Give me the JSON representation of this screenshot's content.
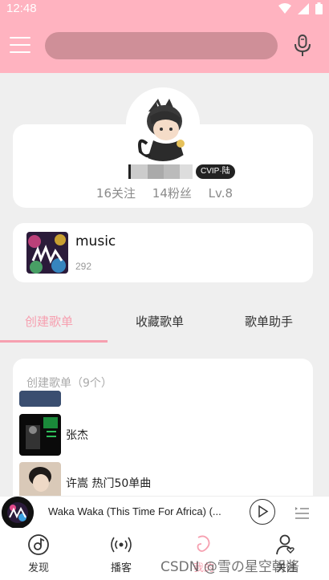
{
  "status_bar": {
    "time": "12:48"
  },
  "search": {
    "placeholder": ""
  },
  "profile": {
    "vip_badge": "CVIP·陆",
    "follow": "16关注",
    "fans": "14粉丝",
    "level": "Lv.8"
  },
  "music_card": {
    "title": "music",
    "count": "292"
  },
  "tabs": [
    {
      "label": "创建歌单"
    },
    {
      "label": "收藏歌单"
    },
    {
      "label": "歌单助手"
    }
  ],
  "playlists": {
    "header": "创建歌单（9个）",
    "items": [
      {
        "name": ""
      },
      {
        "name": "张杰"
      },
      {
        "name": "许嵩 热门50单曲"
      }
    ]
  },
  "player": {
    "title": "Waka Waka (This Time For Africa) (..."
  },
  "bottom_nav": [
    {
      "label": "发现"
    },
    {
      "label": "播客"
    },
    {
      "label": "我的"
    },
    {
      "label": "关注"
    }
  ],
  "watermark": "CSDN @雪の星空朝酱",
  "colors": {
    "accent": "#ffb3c0",
    "tab_active": "#f6a0b0",
    "search_bg": "#cf8f98"
  }
}
